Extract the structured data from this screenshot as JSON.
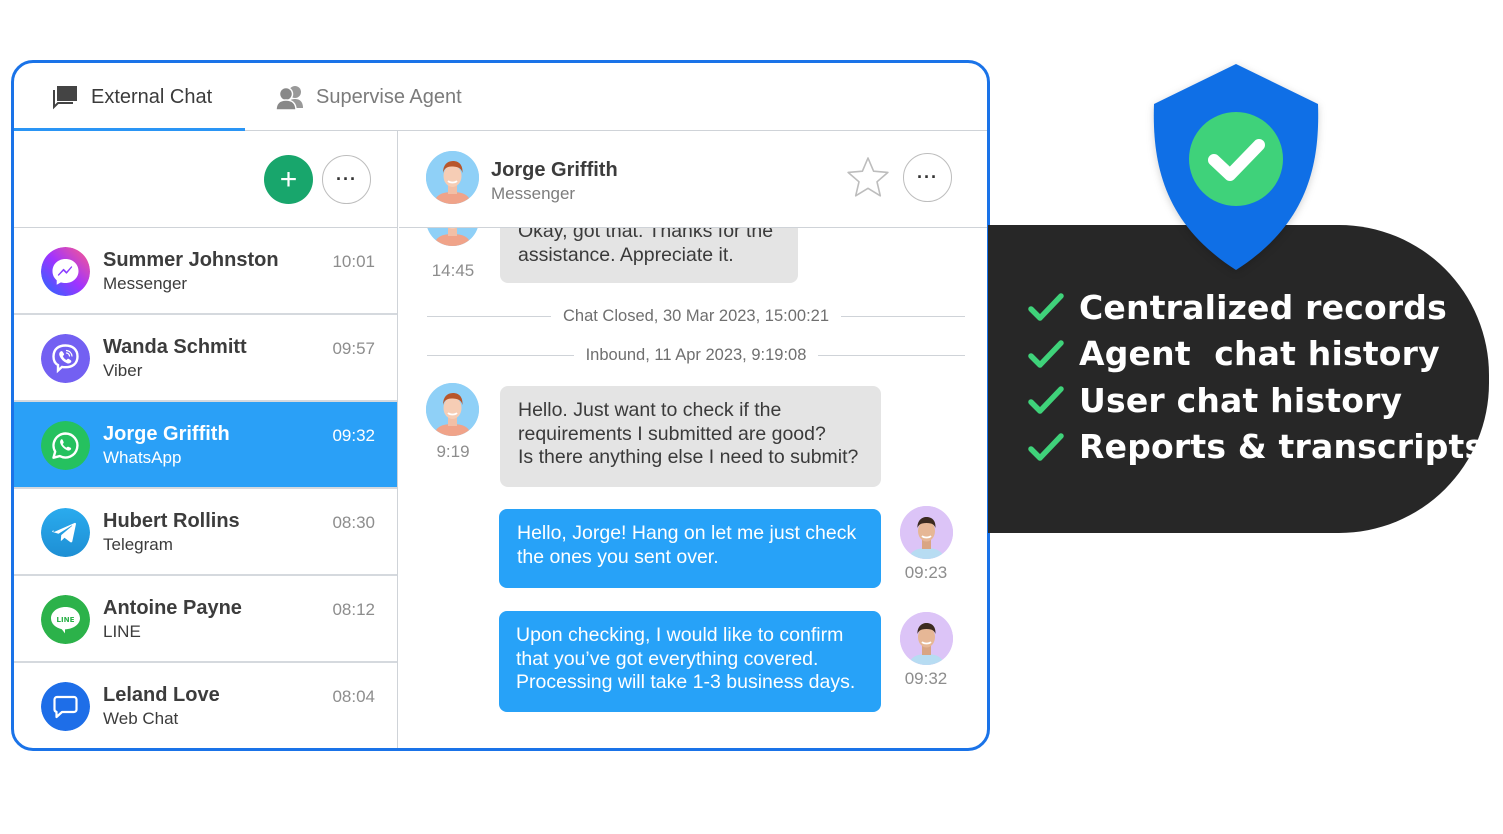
{
  "tabs": [
    {
      "label": "External Chat",
      "icon": "chat-bubbles-icon",
      "active": true
    },
    {
      "label": "Supervise Agent",
      "icon": "users-icon",
      "active": false
    }
  ],
  "toolbar": {
    "add_label": "+",
    "more_label": "···"
  },
  "conversations": [
    {
      "name": "Summer Johnston",
      "channel": "Messenger",
      "time": "10:01",
      "icon": "messenger-icon",
      "selected": false
    },
    {
      "name": "Wanda Schmitt",
      "channel": "Viber",
      "time": "09:57",
      "icon": "viber-icon",
      "selected": false
    },
    {
      "name": "Jorge Griffith",
      "channel": "WhatsApp",
      "time": "09:32",
      "icon": "whatsapp-icon",
      "selected": true
    },
    {
      "name": "Hubert Rollins",
      "channel": "Telegram",
      "time": "08:30",
      "icon": "telegram-icon",
      "selected": false
    },
    {
      "name": "Antoine Payne",
      "channel": "LINE",
      "time": "08:12",
      "icon": "line-icon",
      "selected": false
    },
    {
      "name": "Leland Love",
      "channel": "Web Chat",
      "time": "08:04",
      "icon": "web-chat-icon",
      "selected": false
    }
  ],
  "chat": {
    "contact_name": "Jorge Griffith",
    "contact_channel": "Messenger",
    "more_label": "···",
    "messages": [
      {
        "direction": "in",
        "text": "Okay, got that. Thanks for the assistance. Appreciate it.",
        "time": "14:45"
      },
      {
        "type": "divider",
        "text": "Chat Closed, 30 Mar 2023, 15:00:21"
      },
      {
        "type": "divider",
        "text": "Inbound, 11 Apr 2023, 9:19:08"
      },
      {
        "direction": "in",
        "lines": [
          "Hello. Just want to check if the",
          "requirements I submitted are good?",
          "Is there anything else I need to submit?"
        ],
        "time": "9:19"
      },
      {
        "direction": "out",
        "lines": [
          "Hello, Jorge! Hang on let me just check",
          "the ones you sent over."
        ],
        "time": "09:23"
      },
      {
        "direction": "out",
        "lines": [
          "Upon checking, I would like to confirm",
          "that you’ve got everything covered.",
          "Processing will take 1-3 business days."
        ],
        "time": "09:32"
      }
    ]
  },
  "promo": {
    "features": [
      "Centralized records",
      "Agent  chat history",
      "User chat history",
      "Reports & transcripts"
    ]
  },
  "colors": {
    "frame": "#1a73e8",
    "selected_row": "#2aa0f7",
    "outgoing_bubble": "#27a2f8",
    "incoming_bubble": "#e4e4e4",
    "add_button": "#18a66c",
    "promo_bg": "#272727",
    "check_green": "#3fd27a",
    "shield_blue": "#0f6fe6"
  }
}
